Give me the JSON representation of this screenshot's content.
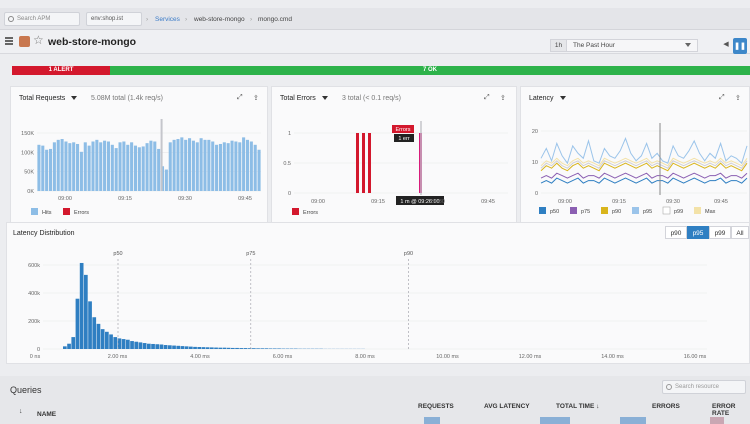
{
  "topbar": {
    "search_placeholder": "Search APM",
    "env_label": "env:shop.ist",
    "breadcrumb": [
      "Services",
      "web-store-mongo",
      "mongo.cmd"
    ]
  },
  "header": {
    "title": "web-store-mongo",
    "time_shortcut": "1h",
    "time_range": "The Past Hour",
    "prev_button": "◀",
    "pause_button": "❚❚"
  },
  "status": {
    "alert_label": "1 ALERT",
    "ok_label": "7 OK",
    "alert_color": "#d3182d",
    "ok_color": "#2db24a"
  },
  "total_requests": {
    "title": "Total Requests",
    "subtitle": "5.08M total (1.4k req/s)",
    "legend": [
      "Hits",
      "Errors"
    ]
  },
  "total_errors": {
    "title": "Total Errors",
    "subtitle": "3 total (< 0.1 req/s)",
    "legend": [
      "Errors"
    ],
    "tooltip_title": "Errors",
    "tooltip_value": "1 err",
    "cursor_label": "1 m @ 09:26:00"
  },
  "latency": {
    "title": "Latency",
    "legend": [
      "p50",
      "p75",
      "p90",
      "p95",
      "p99",
      "Max"
    ]
  },
  "latency_distribution": {
    "title": "Latency Distribution",
    "percentile_buttons": [
      "p90",
      "p95",
      "p99",
      "All"
    ],
    "active_button": "p95"
  },
  "queries": {
    "title": "Queries",
    "search_placeholder": "Search resource",
    "sort_icon": "↓",
    "columns": [
      "NAME",
      "REQUESTS",
      "AVG LATENCY",
      "TOTAL TIME ↓",
      "ERRORS",
      "ERROR RATE"
    ]
  },
  "colors": {
    "accent": "#2f7fc2",
    "hits": "#8dbde6",
    "errors": "#d3182d"
  },
  "chart_data": [
    {
      "type": "bar",
      "name": "total_requests",
      "x_ticks": [
        "09:00",
        "09:15",
        "09:30",
        "09:45"
      ],
      "y_ticks": [
        "0K",
        "50K",
        "100K",
        "150K"
      ],
      "ylim": [
        0,
        160
      ],
      "series": [
        {
          "name": "Hits",
          "values": [
            112,
            110,
            100,
            102,
            118,
            124,
            126,
            120,
            116,
            118,
            114,
            95,
            118,
            110,
            120,
            124,
            118,
            122,
            120,
            112,
            104,
            118,
            120,
            112,
            118,
            110,
            106,
            108,
            116,
            122,
            120,
            102,
            60,
            52,
            118,
            124,
            126,
            130,
            124,
            128,
            122,
            118,
            128,
            124,
            124,
            120,
            112,
            114,
            118,
            116,
            122,
            120,
            118,
            130,
            124,
            120,
            112,
            100
          ]
        },
        {
          "name": "Errors",
          "values": [
            0,
            0,
            0,
            0,
            0,
            0,
            0,
            0,
            0,
            0,
            0,
            0,
            0,
            0,
            0,
            0,
            0,
            0,
            0,
            0,
            0,
            0,
            0,
            0,
            0,
            0,
            0,
            0,
            0,
            0,
            0,
            0,
            0,
            0,
            0,
            0,
            0,
            0,
            0,
            0,
            0,
            0,
            0,
            0,
            0,
            0,
            0,
            0,
            0,
            0,
            0,
            0,
            0,
            0,
            0,
            0,
            0,
            0
          ]
        }
      ]
    },
    {
      "type": "bar",
      "name": "total_errors",
      "x_ticks": [
        "09:00",
        "09:15",
        "09:30",
        "09:45"
      ],
      "y_ticks": [
        "0",
        "0.5",
        "1"
      ],
      "ylim": [
        0,
        1.1
      ],
      "x": [
        "09:11",
        "09:12",
        "09:14",
        "09:26"
      ],
      "series": [
        {
          "name": "Errors",
          "values": [
            1,
            1,
            1,
            1
          ]
        }
      ]
    },
    {
      "type": "line",
      "name": "latency",
      "x_ticks": [
        "09:00",
        "09:15",
        "09:30",
        "09:45"
      ],
      "y_ticks": [
        "0",
        "10",
        "20"
      ],
      "ylim": [
        0,
        25
      ],
      "series": [
        {
          "name": "p50",
          "values": [
            4,
            5,
            4,
            6,
            5,
            4,
            5,
            6,
            4,
            5,
            5,
            4,
            6,
            5,
            4,
            5,
            6,
            5,
            4,
            5,
            6,
            4,
            5,
            5,
            4,
            6,
            5,
            4,
            5,
            6,
            5,
            4,
            5,
            5,
            6,
            4,
            5,
            5,
            4,
            6
          ]
        },
        {
          "name": "p75",
          "values": [
            6,
            7,
            6,
            8,
            7,
            6,
            7,
            8,
            6,
            7,
            7,
            6,
            8,
            7,
            6,
            7,
            8,
            7,
            6,
            7,
            8,
            6,
            7,
            7,
            6,
            8,
            7,
            6,
            7,
            8,
            7,
            6,
            7,
            7,
            8,
            6,
            7,
            7,
            6,
            8
          ]
        },
        {
          "name": "p90",
          "values": [
            9,
            11,
            10,
            12,
            10,
            9,
            11,
            12,
            10,
            11,
            10,
            9,
            12,
            11,
            10,
            11,
            12,
            11,
            10,
            11,
            12,
            10,
            11,
            10,
            9,
            12,
            11,
            10,
            11,
            12,
            11,
            10,
            11,
            10,
            12,
            10,
            11,
            10,
            9,
            12
          ]
        },
        {
          "name": "p95",
          "values": [
            14,
            18,
            13,
            20,
            15,
            12,
            19,
            16,
            14,
            21,
            13,
            12,
            18,
            15,
            14,
            17,
            22,
            16,
            13,
            15,
            20,
            14,
            16,
            13,
            12,
            19,
            15,
            14,
            17,
            21,
            16,
            13,
            16,
            14,
            20,
            13,
            15,
            14,
            12,
            19
          ]
        },
        {
          "name": "p99",
          "values": [
            10,
            12,
            11,
            13,
            11,
            10,
            12,
            13,
            11,
            12,
            11,
            10,
            13,
            12,
            11,
            12,
            13,
            12,
            11,
            12,
            13,
            11,
            12,
            11,
            10,
            13,
            12,
            11,
            12,
            13,
            12,
            11,
            12,
            11,
            13,
            11,
            12,
            11,
            10,
            13
          ]
        },
        {
          "name": "Max",
          "values": [
            11,
            13,
            12,
            14,
            12,
            11,
            13,
            14,
            12,
            13,
            12,
            11,
            14,
            13,
            12,
            13,
            14,
            13,
            12,
            13,
            14,
            12,
            13,
            12,
            11,
            14,
            13,
            12,
            13,
            14,
            13,
            12,
            13,
            12,
            14,
            12,
            13,
            12,
            11,
            14
          ]
        }
      ]
    },
    {
      "type": "bar",
      "name": "latency_distribution",
      "x_ticks": [
        "0 ns",
        "2.00 ms",
        "4.00 ms",
        "6.00 ms",
        "8.00 ms",
        "10.00 ms",
        "12.00 ms",
        "14.00 ms",
        "16.00 ms"
      ],
      "y_ticks": [
        "0",
        "200k",
        "400k",
        "600k"
      ],
      "markers": [
        "p50",
        "p75",
        "p90"
      ],
      "marker_ms": [
        2.0,
        5.2,
        9.0
      ],
      "ylim": [
        0,
        680
      ],
      "values": [
        20,
        40,
        90,
        380,
        650,
        560,
        360,
        240,
        190,
        150,
        130,
        110,
        90,
        80,
        75,
        70,
        60,
        55,
        50,
        45,
        40,
        38,
        36,
        34,
        30,
        28,
        26,
        24,
        22,
        20,
        18,
        16,
        15,
        14,
        13,
        12,
        11,
        10,
        10,
        9,
        8,
        8,
        7,
        7,
        6,
        6,
        5,
        5,
        5,
        4,
        4,
        4,
        3,
        3,
        3,
        3,
        2,
        2,
        2,
        2,
        2,
        2,
        1,
        1,
        1,
        1,
        1,
        1,
        1,
        1,
        1,
        1
      ]
    }
  ]
}
